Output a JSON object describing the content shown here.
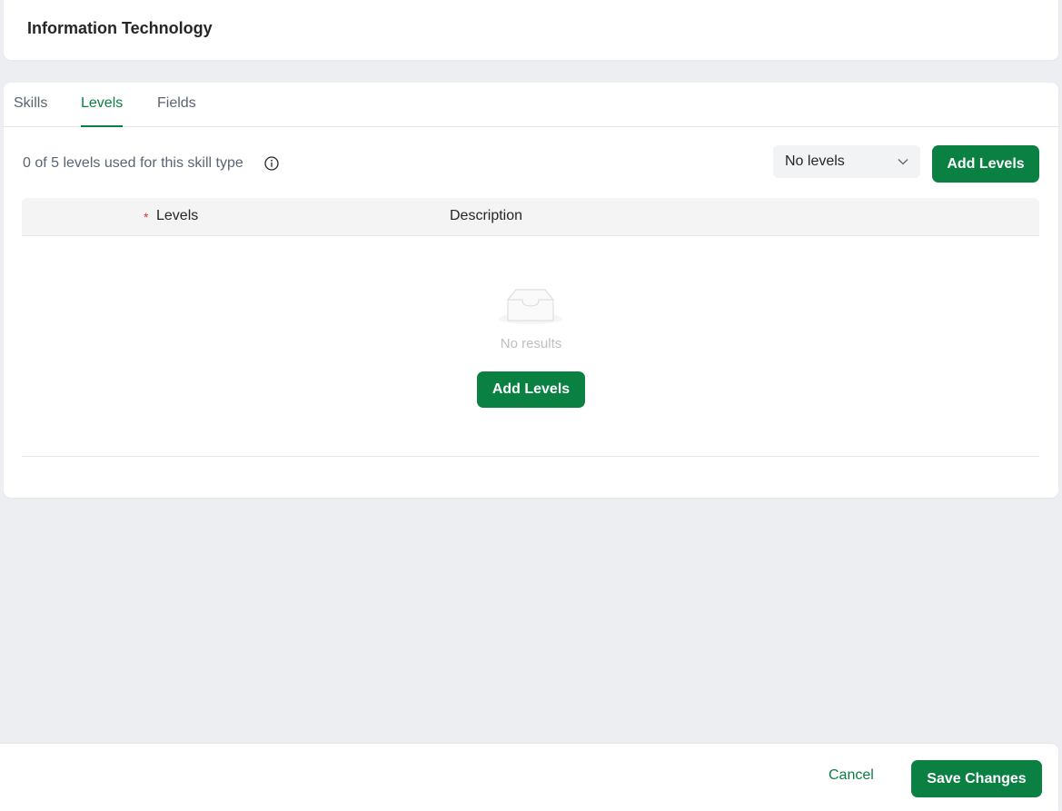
{
  "header": {
    "title": "Information Technology"
  },
  "tabs": [
    {
      "label": "Skills",
      "active": false
    },
    {
      "label": "Levels",
      "active": true
    },
    {
      "label": "Fields",
      "active": false
    }
  ],
  "toolbar": {
    "usage_text": "0 of 5 levels used for this skill type",
    "select_value": "No levels",
    "add_levels_label": "Add Levels"
  },
  "table": {
    "columns": [
      {
        "label": "Levels",
        "required": true,
        "required_mark": "*"
      },
      {
        "label": "Description",
        "required": false
      }
    ],
    "empty_text": "No results",
    "empty_add_label": "Add Levels"
  },
  "footer": {
    "cancel_label": "Cancel",
    "save_label": "Save Changes"
  },
  "icons": {
    "info": "info-circle-icon",
    "chevron": "chevron-down-icon",
    "empty": "empty-inbox-icon"
  },
  "colors": {
    "accent": "#0a8043",
    "background": "#eceef1",
    "required": "#d9363e",
    "muted_text": "#5a6473"
  }
}
